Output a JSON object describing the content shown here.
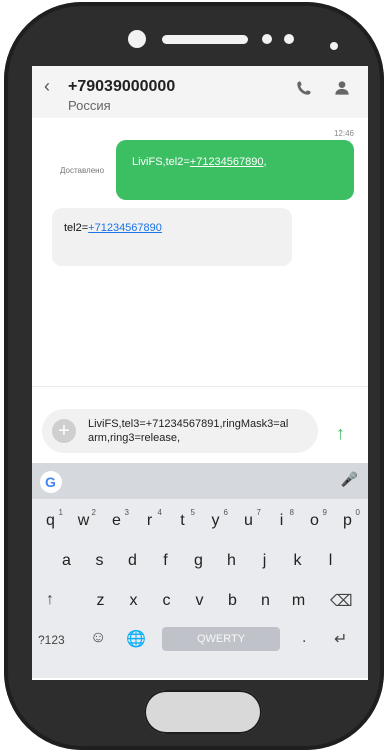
{
  "header": {
    "phone_number": "+79039000000",
    "country": "Россия"
  },
  "messages": {
    "time": "12:46",
    "delivered_label": "Доставлено",
    "outgoing_prefix": "LiviFS,tel2=",
    "outgoing_link": "+71234567890",
    "outgoing_suffix": ",",
    "incoming_prefix": "tel2=",
    "incoming_link": "+71234567890"
  },
  "composer": {
    "line1": "LiviFS,tel3=+71234567891,ringMask3=al",
    "line2": "arm,ring3=release,"
  },
  "keyboard": {
    "row1": [
      "q",
      "w",
      "e",
      "r",
      "t",
      "y",
      "u",
      "i",
      "o",
      "p"
    ],
    "row1_digits": [
      "1",
      "2",
      "3",
      "4",
      "5",
      "6",
      "7",
      "8",
      "9",
      "0"
    ],
    "row2": [
      "a",
      "s",
      "d",
      "f",
      "g",
      "h",
      "j",
      "k",
      "l"
    ],
    "row3": [
      "z",
      "x",
      "c",
      "v",
      "b",
      "n",
      "m"
    ],
    "bottom_numbers": "?123",
    "space_label": "QWERTY",
    "dot": "."
  },
  "icons": {
    "back": "chevron-left-icon",
    "call": "phone-icon",
    "contact": "person-icon",
    "add": "plus-icon",
    "send": "arrow-up-icon",
    "google": "google-icon",
    "mic": "microphone-icon",
    "shift": "shift-icon",
    "backspace": "backspace-icon",
    "emoji": "emoji-icon",
    "globe": "globe-icon",
    "enter": "enter-icon"
  }
}
